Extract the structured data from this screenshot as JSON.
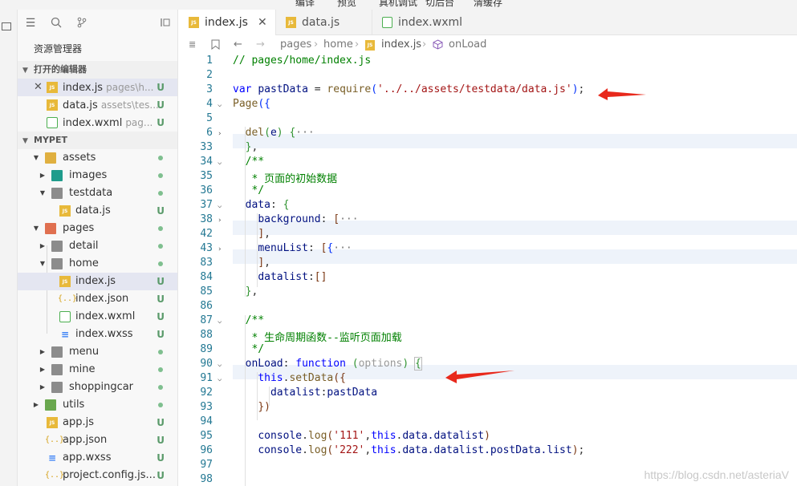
{
  "menu": {
    "items": [
      "编译",
      "预览",
      "真机调试",
      "切后台",
      "清缓存"
    ]
  },
  "sidebar": {
    "title": "资源管理器",
    "open_editors_label": "打开的编辑器",
    "project_label": "MYPET",
    "open_editors": [
      {
        "name": "index.js",
        "path": "pages\\h...",
        "status": "U"
      },
      {
        "name": "data.js",
        "path": "assets\\tes...",
        "status": "U"
      },
      {
        "name": "index.wxml",
        "path": "pag...",
        "status": "U"
      }
    ],
    "tree": [
      {
        "name": "assets",
        "status": "dot"
      },
      {
        "name": "images",
        "status": "dot"
      },
      {
        "name": "testdata",
        "status": "dot"
      },
      {
        "name": "data.js",
        "status": "U"
      },
      {
        "name": "pages",
        "status": "dot"
      },
      {
        "name": "detail",
        "status": "dot"
      },
      {
        "name": "home",
        "status": "dot"
      },
      {
        "name": "index.js",
        "status": "U"
      },
      {
        "name": "index.json",
        "status": "U"
      },
      {
        "name": "index.wxml",
        "status": "U"
      },
      {
        "name": "index.wxss",
        "status": "U"
      },
      {
        "name": "menu",
        "status": "dot"
      },
      {
        "name": "mine",
        "status": "dot"
      },
      {
        "name": "shoppingcar",
        "status": "dot"
      },
      {
        "name": "utils",
        "status": "dot"
      },
      {
        "name": "app.js",
        "status": "U"
      },
      {
        "name": "app.json",
        "status": "U"
      },
      {
        "name": "app.wxss",
        "status": "U"
      },
      {
        "name": "project.config.js...",
        "status": "U"
      }
    ]
  },
  "tabs": [
    {
      "label": "index.js",
      "active": true
    },
    {
      "label": "data.js",
      "active": false
    },
    {
      "label": "index.wxml",
      "active": false
    }
  ],
  "breadcrumb": [
    "pages",
    "home",
    "index.js",
    "onLoad"
  ],
  "code": {
    "line_numbers": [
      "1",
      "2",
      "3",
      "4",
      "5",
      "6",
      "33",
      "34",
      "35",
      "36",
      "37",
      "38",
      "42",
      "43",
      "83",
      "84",
      "85",
      "86",
      "87",
      "88",
      "89",
      "90",
      "91",
      "92",
      "93",
      "94",
      "95",
      "96",
      "97",
      "98"
    ],
    "l1": "// pages/home/index.js",
    "l3_kw": "var",
    "l3_id": "pastData",
    "l3_eq": " = ",
    "l3_fn": "require",
    "l3_str": "'../../assets/testdata/data.js'",
    "l4_fn": "Page",
    "l6_fn": "del",
    "l6_param": "e",
    "l6_dots": "···",
    "l34": "/**",
    "l35": " * 页面的初始数据",
    "l36": " */",
    "l37": "data",
    "l38": "background",
    "l43": "menuList",
    "l84": "datalist",
    "l87": "/**",
    "l88": " * 生命周期函数--监听页面加载",
    "l89": " */",
    "l90_id": "onLoad",
    "l90_kw": "function",
    "l90_param": "options",
    "l91_this": "this",
    "l91_fn": "setData",
    "l92_a": "datalist",
    "l92_b": "pastData",
    "l95_a": "console",
    "l95_fn": "log",
    "l95_str": "'111'",
    "l95_rest": "data.datalist",
    "l96_str": "'222'",
    "l96_rest": "data.datalist.postData.list"
  },
  "watermark": "https://blog.csdn.net/asteriaV",
  "colors": {
    "annotation_arrow": "#e8291c",
    "line_number": "#237893",
    "keyword": "#0000ff",
    "comment": "#008000",
    "string": "#a31515"
  }
}
